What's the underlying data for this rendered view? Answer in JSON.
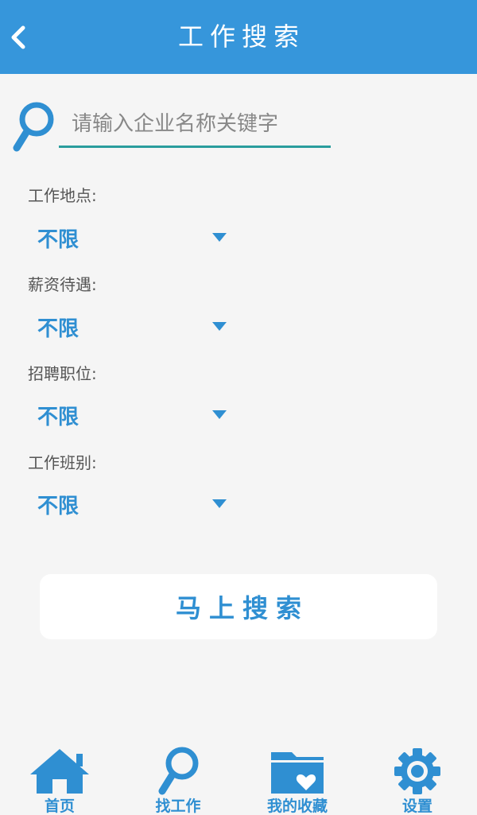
{
  "header": {
    "title": "工作搜索",
    "back_icon": "chevron-left-icon"
  },
  "search": {
    "placeholder": "请输入企业名称关键字",
    "value": "",
    "icon": "magnifier-icon"
  },
  "filters": [
    {
      "label": "工作地点:",
      "value": "不限"
    },
    {
      "label": "薪资待遇:",
      "value": "不限"
    },
    {
      "label": "招聘职位:",
      "value": "不限"
    },
    {
      "label": "工作班别:",
      "value": "不限"
    }
  ],
  "search_button": {
    "label": "马上搜索"
  },
  "bottom_nav": [
    {
      "label": "首页",
      "icon": "home-icon"
    },
    {
      "label": "找工作",
      "icon": "find-job-icon"
    },
    {
      "label": "我的收藏",
      "icon": "favorites-folder-icon"
    },
    {
      "label": "设置",
      "icon": "gear-icon"
    }
  ],
  "colors": {
    "header_bg": "#3696db",
    "accent": "#2f8fd2",
    "underline": "#2a9d9d",
    "page_bg": "#f5f5f5"
  }
}
